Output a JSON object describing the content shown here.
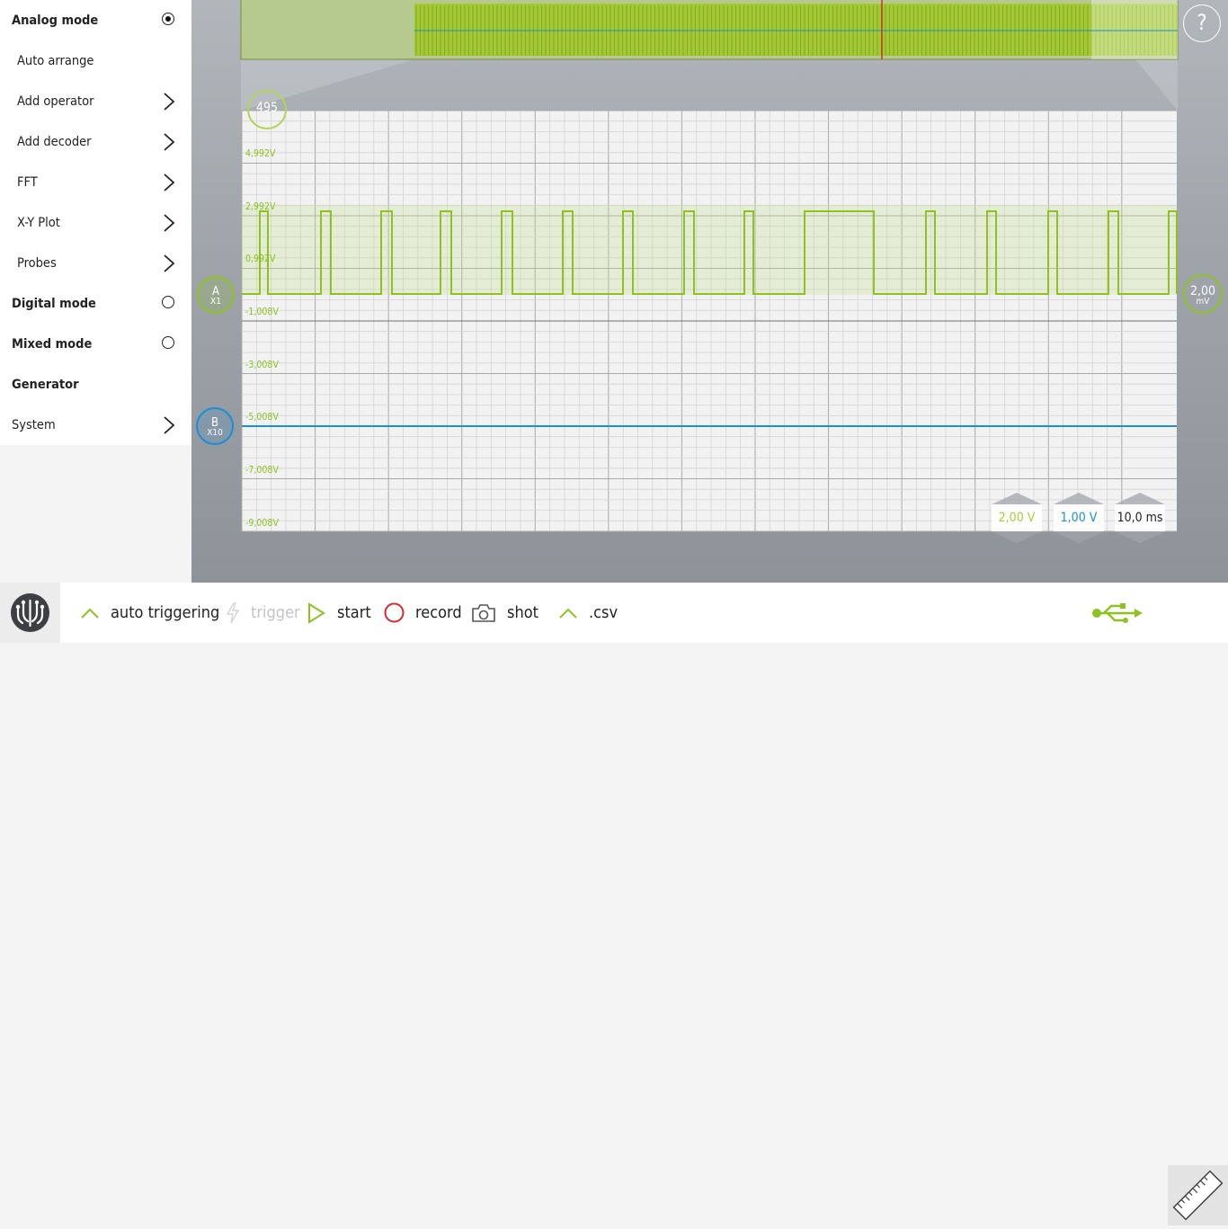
{
  "sidebar": {
    "items": [
      {
        "label": "Analog mode",
        "kind": "radio",
        "selected": true
      },
      {
        "label": "Auto arrange",
        "kind": "action"
      },
      {
        "label": "Add operator",
        "kind": "submenu"
      },
      {
        "label": "Add decoder",
        "kind": "submenu"
      },
      {
        "label": "FFT",
        "kind": "submenu"
      },
      {
        "label": "X-Y Plot",
        "kind": "submenu"
      },
      {
        "label": "Probes",
        "kind": "submenu"
      },
      {
        "label": "Digital mode",
        "kind": "radio",
        "selected": false
      },
      {
        "label": "Mixed mode",
        "kind": "radio",
        "selected": false
      },
      {
        "label": "Generator",
        "kind": "header"
      },
      {
        "label": "System",
        "kind": "submenu"
      }
    ]
  },
  "help": {
    "label": "?"
  },
  "trigger_position": {
    "label": "495"
  },
  "channel_a": {
    "name": "A",
    "probe": "X1",
    "color": "#8dc21f"
  },
  "channel_b": {
    "name": "B",
    "probe": "X10",
    "color": "#1a8ed8"
  },
  "offset": {
    "value": "2,00",
    "unit": "mV"
  },
  "y_axis_labels": [
    "4,992V",
    "2,992V",
    "0,992V",
    "-1,008V",
    "-3,008V",
    "-5,008V",
    "-7,008V",
    "-9,008V"
  ],
  "scales": {
    "ch_a_volts": {
      "label": "2,00 V",
      "color": "#a9cc3a"
    },
    "ch_b_volts": {
      "label": "1,00 V",
      "color": "#1a8ed8"
    },
    "time": {
      "label": "10,0 ms",
      "color": "#222222"
    }
  },
  "toolbar": {
    "auto_triggering": "auto triggering",
    "trigger": "trigger",
    "start": "start",
    "record": "record",
    "shot": "shot",
    "csv": ".csv"
  },
  "icons": {
    "logo": "redpitaya-logo-icon",
    "usb": "usb-icon",
    "ruler": "ruler-icon",
    "help": "help-icon"
  },
  "colors": {
    "accent_green": "#8dc21f",
    "accent_blue": "#1a8ed8",
    "record_red": "#d62b2b"
  }
}
